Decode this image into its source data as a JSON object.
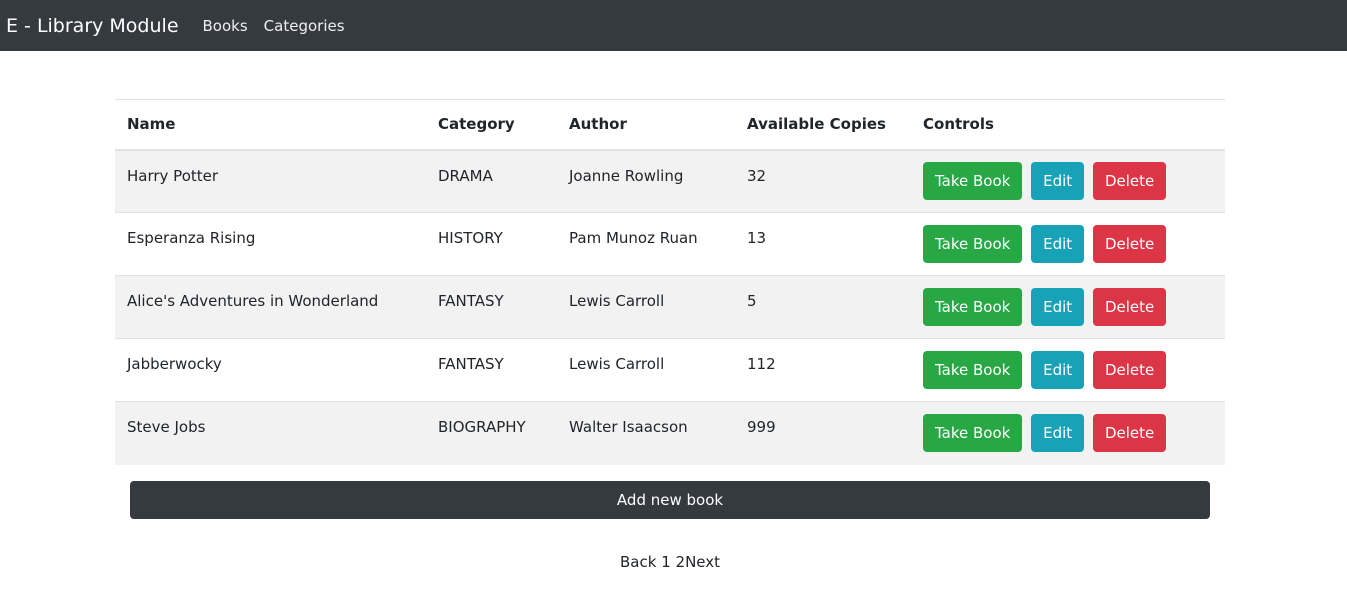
{
  "navbar": {
    "brand": "E - Library Module",
    "links": [
      "Books",
      "Categories"
    ]
  },
  "table": {
    "headers": [
      "Name",
      "Category",
      "Author",
      "Available Copies",
      "Controls"
    ],
    "rows": [
      {
        "name": "Harry Potter",
        "category": "DRAMA",
        "author": "Joanne Rowling",
        "copies": "32"
      },
      {
        "name": "Esperanza Rising",
        "category": "HISTORY",
        "author": "Pam Munoz Ruan",
        "copies": "13"
      },
      {
        "name": "Alice's Adventures in Wonderland",
        "category": "FANTASY",
        "author": "Lewis Carroll",
        "copies": "5"
      },
      {
        "name": "Jabberwocky",
        "category": "FANTASY",
        "author": "Lewis Carroll",
        "copies": "112"
      },
      {
        "name": "Steve Jobs",
        "category": "BIOGRAPHY",
        "author": "Walter Isaacson",
        "copies": "999"
      }
    ],
    "buttons": {
      "take": "Take Book",
      "edit": "Edit",
      "delete": "Delete"
    }
  },
  "add_button": "Add new book",
  "pagination": {
    "back": "Back",
    "pages": [
      "1",
      "2"
    ],
    "next": "Next"
  },
  "colors": {
    "navbar_bg": "#343a40",
    "take_book": "#28a745",
    "edit": "#17a2b8",
    "delete": "#dc3545",
    "stripe": "#f2f2f2"
  }
}
